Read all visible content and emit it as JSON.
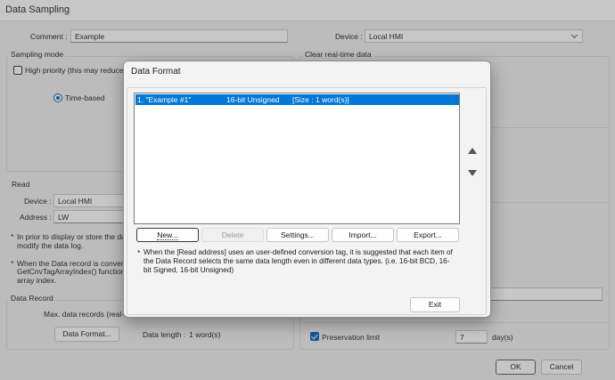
{
  "window": {
    "title": "Data Sampling",
    "comment_label": "Comment :",
    "comment_value": "Example",
    "device_label": "Device :",
    "device_value": "Local HMI",
    "sampling_mode_title": "Sampling mode",
    "high_priority_label": "High priority (this may reduce r",
    "time_based_label": "Time-based",
    "clear_title": "Clear real-time data",
    "read_title": "Read",
    "read_device_label": "Device :",
    "read_device_value": "Local HMI",
    "address_label": "Address :",
    "address_value": "LW",
    "note1_line1": "In prior to display or store the da",
    "note1_line2": "modify the data log.",
    "note2_line1": "When the Data record is converte",
    "note2_line2": "GetCnvTagArrayIndex() function",
    "note2_line3": "array index.",
    "data_record_title": "Data Record",
    "max_records_label": "Max. data records (real-t",
    "data_format_button": "Data Format...",
    "data_length_label": "Data length :",
    "data_length_value": "1 word(s)",
    "preservation_label": "Preservation limit",
    "preservation_value": "7",
    "preservation_unit": "day(s)",
    "ok_button": "OK",
    "cancel_button": "Cancel",
    "bullet": "*"
  },
  "dialog": {
    "title": "Data Format",
    "list_items": [
      {
        "name": "1. \"Example #1\"",
        "type": "16-bit Unsigned",
        "size": "[Size : 1 word(s)]",
        "selected": true
      }
    ],
    "buttons": {
      "new": "New...",
      "delete": "Delete",
      "settings": "Settings...",
      "import": "Import...",
      "export": "Export...",
      "exit": "Exit"
    },
    "note": "When the [Read address] uses an user-defined conversion tag, it is suggested that each item of the Data Record selects the same data length even in different data types. (i.e. 16-bit BCD, 16-bit Signed, 16-bit Unsigned)",
    "note_bullet": "*"
  },
  "colors": {
    "selection": "#0078d7",
    "accent": "#005fb8",
    "window_bg": "#f0f0f0"
  }
}
